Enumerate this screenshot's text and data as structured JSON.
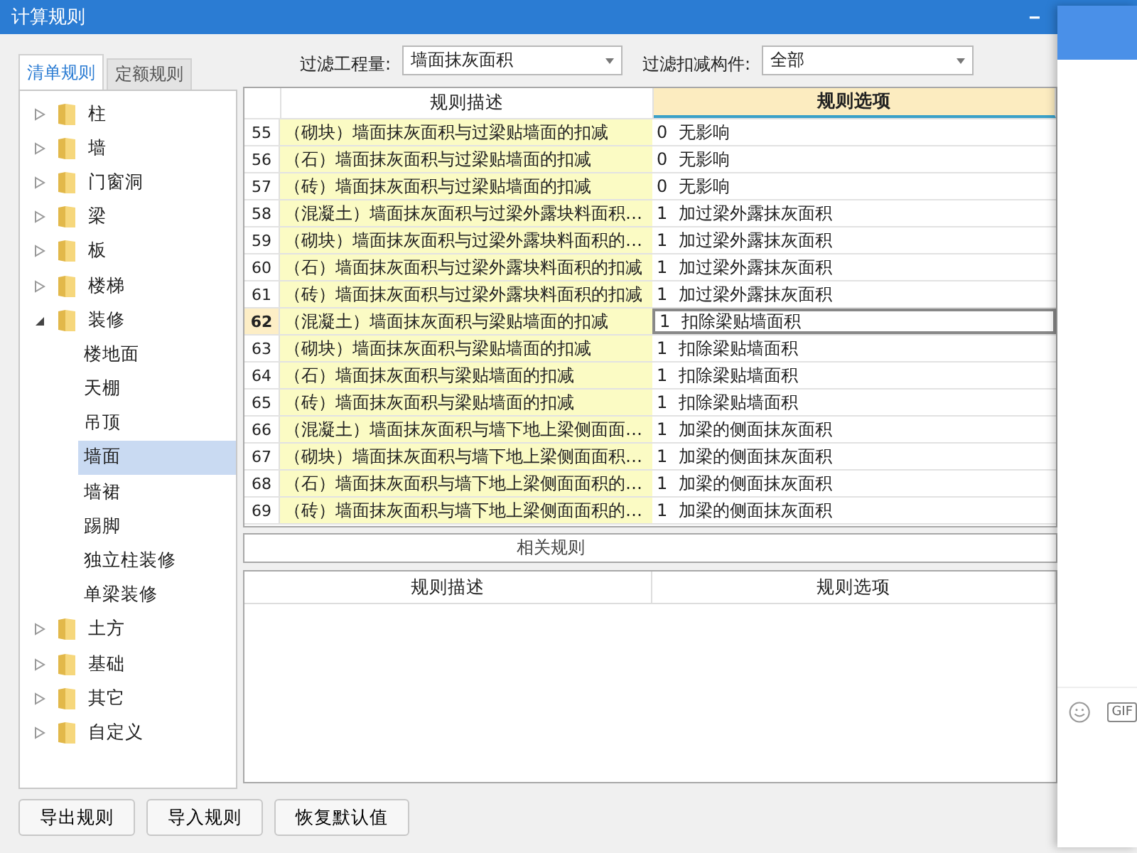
{
  "window": {
    "title": "计算规则",
    "minimize": "−"
  },
  "tabs": [
    {
      "label": "清单规则",
      "selected": true
    },
    {
      "label": "定额规则",
      "selected": false
    }
  ],
  "tree": [
    {
      "label": "柱",
      "expanded": false
    },
    {
      "label": "墙",
      "expanded": false
    },
    {
      "label": "门窗洞",
      "expanded": false
    },
    {
      "label": "梁",
      "expanded": false
    },
    {
      "label": "板",
      "expanded": false
    },
    {
      "label": "楼梯",
      "expanded": false
    },
    {
      "label": "装修",
      "expanded": true,
      "children": [
        {
          "label": "楼地面",
          "selected": false
        },
        {
          "label": "天棚",
          "selected": false
        },
        {
          "label": "吊顶",
          "selected": false
        },
        {
          "label": "墙面",
          "selected": true
        },
        {
          "label": "墙裙",
          "selected": false
        },
        {
          "label": "踢脚",
          "selected": false
        },
        {
          "label": "独立柱装修",
          "selected": false
        },
        {
          "label": "单梁装修",
          "selected": false
        }
      ]
    },
    {
      "label": "土方",
      "expanded": false
    },
    {
      "label": "基础",
      "expanded": false
    },
    {
      "label": "其它",
      "expanded": false
    },
    {
      "label": "自定义",
      "expanded": false
    }
  ],
  "filters": [
    {
      "label": "过滤工程量:",
      "value": "墙面抹灰面积"
    },
    {
      "label": "过滤扣减构件:",
      "value": "全部"
    }
  ],
  "table": {
    "columns": [
      "规则描述",
      "规则选项"
    ],
    "rows": [
      {
        "no": "55",
        "desc": "（砌块）墙面抹灰面积与过梁贴墙面的扣减",
        "code": "0",
        "option": "无影响",
        "selected": false
      },
      {
        "no": "56",
        "desc": "（石）墙面抹灰面积与过梁贴墙面的扣减",
        "code": "0",
        "option": "无影响",
        "selected": false
      },
      {
        "no": "57",
        "desc": "（砖）墙面抹灰面积与过梁贴墙面的扣减",
        "code": "0",
        "option": "无影响",
        "selected": false
      },
      {
        "no": "58",
        "desc": "（混凝土）墙面抹灰面积与过梁外露块料面积…",
        "code": "1",
        "option": "加过梁外露抹灰面积",
        "selected": false
      },
      {
        "no": "59",
        "desc": "（砌块）墙面抹灰面积与过梁外露块料面积的…",
        "code": "1",
        "option": "加过梁外露抹灰面积",
        "selected": false
      },
      {
        "no": "60",
        "desc": "（石）墙面抹灰面积与过梁外露块料面积的扣减",
        "code": "1",
        "option": "加过梁外露抹灰面积",
        "selected": false
      },
      {
        "no": "61",
        "desc": "（砖）墙面抹灰面积与过梁外露块料面积的扣减",
        "code": "1",
        "option": "加过梁外露抹灰面积",
        "selected": false
      },
      {
        "no": "62",
        "desc": "（混凝土）墙面抹灰面积与梁贴墙面的扣减",
        "code": "1",
        "option": "扣除梁贴墙面积",
        "selected": true
      },
      {
        "no": "63",
        "desc": "（砌块）墙面抹灰面积与梁贴墙面的扣减",
        "code": "1",
        "option": "扣除梁贴墙面积",
        "selected": false
      },
      {
        "no": "64",
        "desc": "（石）墙面抹灰面积与梁贴墙面的扣减",
        "code": "1",
        "option": "扣除梁贴墙面积",
        "selected": false
      },
      {
        "no": "65",
        "desc": "（砖）墙面抹灰面积与梁贴墙面的扣减",
        "code": "1",
        "option": "扣除梁贴墙面积",
        "selected": false
      },
      {
        "no": "66",
        "desc": "（混凝土）墙面抹灰面积与墙下地上梁侧面面…",
        "code": "1",
        "option": "加梁的侧面抹灰面积",
        "selected": false
      },
      {
        "no": "67",
        "desc": "（砌块）墙面抹灰面积与墙下地上梁侧面面积…",
        "code": "1",
        "option": "加梁的侧面抹灰面积",
        "selected": false
      },
      {
        "no": "68",
        "desc": "（石）墙面抹灰面积与墙下地上梁侧面面积的…",
        "code": "1",
        "option": "加梁的侧面抹灰面积",
        "selected": false
      },
      {
        "no": "69",
        "desc": "（砖）墙面抹灰面积与墙下地上梁侧面面积的…",
        "code": "1",
        "option": "加梁的侧面抹灰面积",
        "selected": false
      }
    ]
  },
  "related": {
    "title": "相关规则",
    "columns": [
      "规则描述",
      "规则选项"
    ]
  },
  "buttons": [
    "导出规则",
    "导入规则",
    "恢复默认值"
  ],
  "side_panel": {
    "gif": "GIF"
  }
}
